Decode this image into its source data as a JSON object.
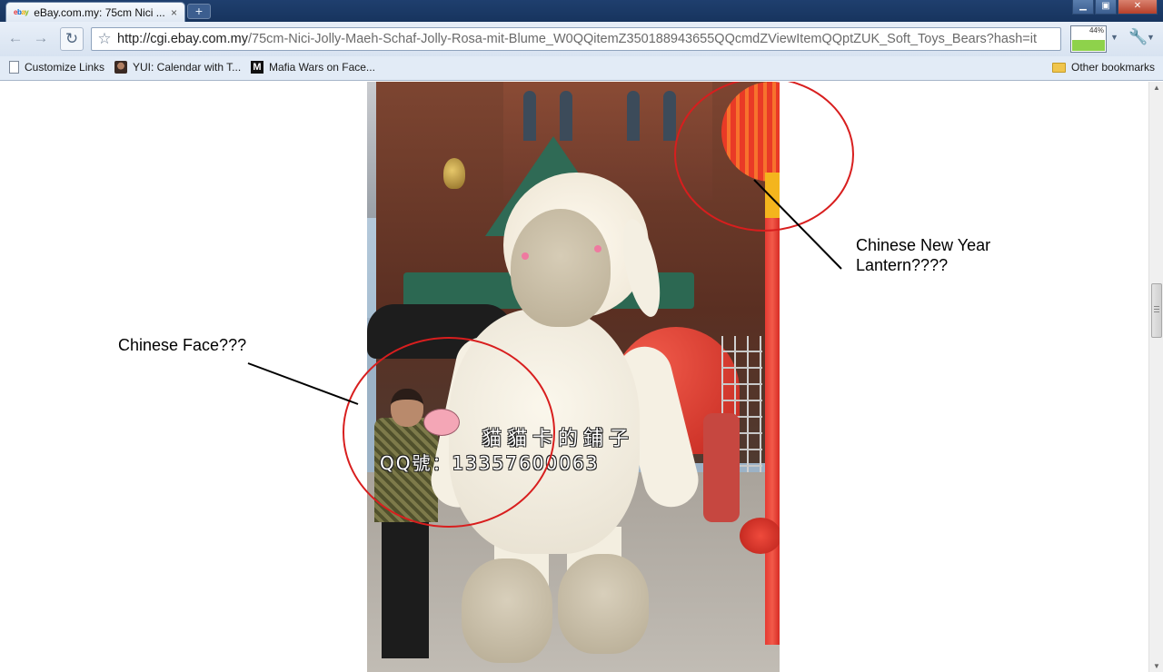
{
  "browser": {
    "tab": {
      "title": "eBay.com.my: 75cm Nici ...",
      "close": "×"
    },
    "new_tab": "+",
    "window_controls": {
      "minimize": "▁",
      "maximize": "▣",
      "close": "✕"
    },
    "url": {
      "domain": "http://cgi.ebay.com.my",
      "path": "/75cm-Nici-Jolly-Maeh-Schaf-Jolly-Rosa-mit-Blume_W0QQitemZ350188943655QQcmdZViewItemQQptZUK_Soft_Toys_Bears?hash=it"
    },
    "battery_label": "44%",
    "battery_level": 0.44
  },
  "bookmarks": {
    "items": [
      {
        "label": "Customize Links",
        "icon": "page-icon"
      },
      {
        "label": "YUI: Calendar with T...",
        "icon": "avatar-icon"
      },
      {
        "label": "Mafia Wars on Face...",
        "icon": "m-icon",
        "icon_text": "M"
      }
    ],
    "other": "Other bookmarks"
  },
  "page": {
    "photo_watermark": {
      "line1": "貓貓卡的鋪子",
      "line2": "QQ號：13357600063"
    },
    "annotations": {
      "face": "Chinese Face???",
      "lantern_line1": "Chinese New Year",
      "lantern_line2": "Lantern????"
    }
  },
  "colors": {
    "annotation_circle": "#d81e1e",
    "annotation_line": "#000000",
    "titlebar": "#1f3f6e",
    "toolbar": "#dfe8f3"
  }
}
